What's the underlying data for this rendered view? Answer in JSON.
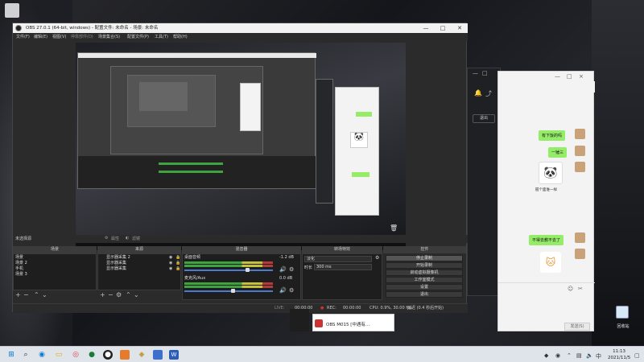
{
  "obs": {
    "title": "OBS 27.0.1 (64-bit, windows) - 配置文件: 未命名 - 场景: 未命名",
    "menu": [
      "文件(F)",
      "编辑(E)",
      "视图(V)",
      "停靠部件(D)",
      "场景集合(S)",
      "配置文件(P)",
      "工具(T)",
      "帮助(H)"
    ],
    "panel_bar": {
      "left": "未选择源",
      "properties": "属性",
      "filters": "滤镜"
    },
    "docks": {
      "scenes": {
        "title": "场景",
        "items": [
          "场景",
          "场景 2",
          "手机",
          "场景 3"
        ]
      },
      "sources": {
        "title": "来源",
        "items": [
          "显示器采集 2",
          "显示器采集",
          "显示器采集"
        ]
      },
      "mixer": {
        "title": "混音器",
        "channels": [
          {
            "name": "桌面音频",
            "db": "-1.2 dB",
            "level": 0.72
          },
          {
            "name": "麦克风/Aux",
            "db": "0.0 dB",
            "level": 0.55
          }
        ]
      },
      "transitions": {
        "title": "转场特效",
        "type": "淡化",
        "duration_label": "时长",
        "duration_value": "300 ms"
      },
      "controls": {
        "title": "控件",
        "buttons": [
          "停止录制",
          "开始录制",
          "启动虚拟摄像机",
          "工作室模式",
          "设置",
          "退出"
        ]
      }
    },
    "status": {
      "live_label": "LIVE:",
      "live_time": "00:00:00",
      "rec_label": "REC:",
      "rec_time": "00:00:00",
      "cpu": "CPU: 0.9%, 30.00 fps"
    },
    "delay_text": "延迟 (0.4 秒后开始)"
  },
  "chat": {
    "messages": [
      "有下饭的吗",
      "一锤三",
      "不得去教不去了"
    ],
    "sticker_caption": "握个面谁一样",
    "send_label": "发送(S)",
    "controls": [
      "—",
      "□",
      "×"
    ],
    "emoji_panda": "🐼",
    "emoji_cat": "🐱"
  },
  "dark_window": {
    "button": "退出",
    "controls": [
      "—",
      "□"
    ]
  },
  "notification": {
    "text": "OBS M015 [中遇有..."
  },
  "desktop": {
    "recycle_label": "回收站"
  },
  "taskbar": {
    "clock_time": "11:13",
    "clock_date": "2021/11/5"
  }
}
